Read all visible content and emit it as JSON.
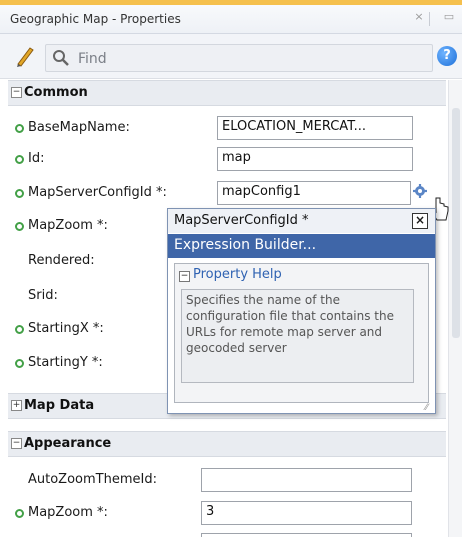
{
  "window": {
    "title": "Geographic Map - Properties"
  },
  "toolbar": {
    "search_placeholder": "Find",
    "help_label": "?"
  },
  "sections": {
    "common": {
      "label": "Common",
      "toggle": "−"
    },
    "map_data": {
      "label": "Map Data",
      "toggle": "+"
    },
    "appearance": {
      "label": "Appearance",
      "toggle": "−"
    }
  },
  "common_props": [
    {
      "label": "BaseMapName:",
      "value": "ELOCATION_MERCAT..."
    },
    {
      "label": "Id:",
      "value": "map"
    },
    {
      "label": "MapServerConfigId *:",
      "value": "mapConfig1"
    },
    {
      "label": "MapZoom *:",
      "value": ""
    },
    {
      "label": "Rendered:",
      "value": ""
    },
    {
      "label": "Srid:",
      "value": ""
    },
    {
      "label": "StartingX *:",
      "value": ""
    },
    {
      "label": "StartingY *:",
      "value": ""
    }
  ],
  "appearance_props": [
    {
      "label": "AutoZoomThemeId:",
      "value": ""
    },
    {
      "label": "MapZoom *:",
      "value": "3"
    }
  ],
  "popup": {
    "title": "MapServerConfigId *",
    "close_label": "×",
    "expression_builder": "Expression Builder...",
    "help_title": "Property Help",
    "help_toggle": "−",
    "help_text": "Specifies the name of the configuration file that contains the URLs for remote map server and geocoded server"
  },
  "colors": {
    "accent": "#f5c04e",
    "selection": "#3f66a8",
    "required_dot": "#43a047",
    "help_link": "#2f62b2"
  }
}
